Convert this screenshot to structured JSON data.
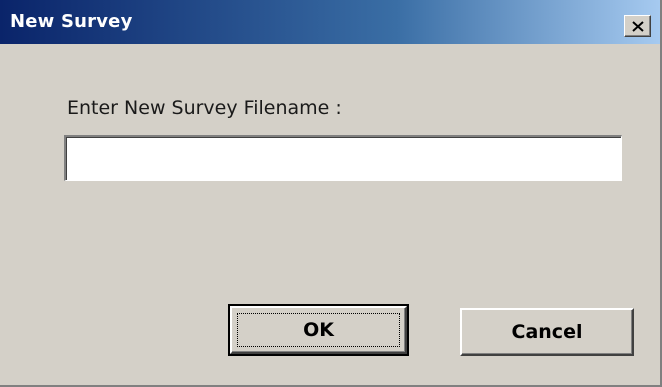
{
  "window": {
    "title": "New Survey",
    "close_icon": "close-icon"
  },
  "form": {
    "label": "Enter New Survey Filename :",
    "filename_value": "",
    "filename_placeholder": ""
  },
  "buttons": {
    "ok_label": "OK",
    "cancel_label": "Cancel"
  },
  "colors": {
    "dialog_bg": "#d4d0c8",
    "titlebar_start": "#0a246a",
    "titlebar_end": "#a6caf0",
    "title_text": "#ffffff"
  }
}
